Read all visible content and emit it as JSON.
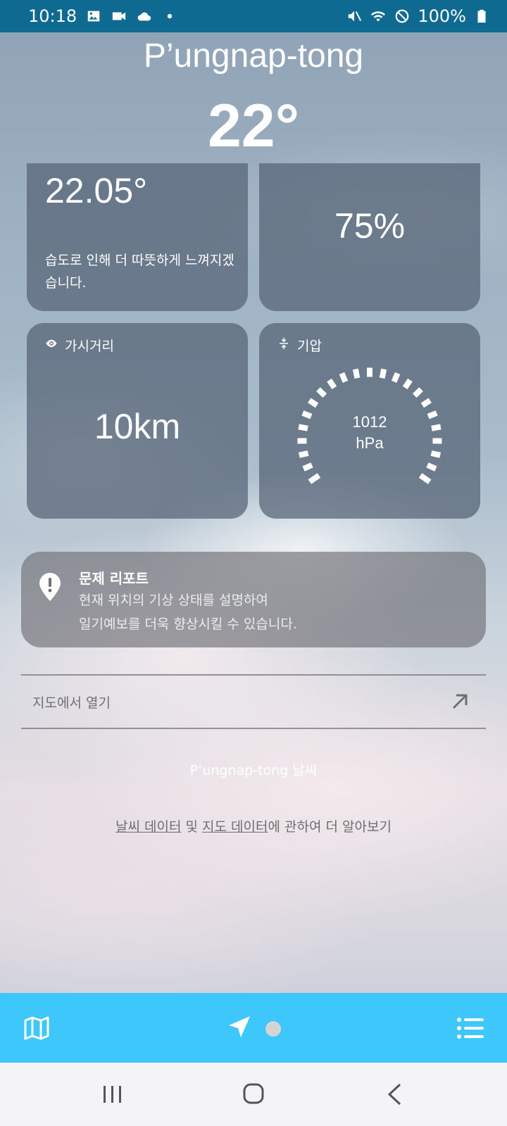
{
  "status_bar": {
    "time": "10:18",
    "battery": "100%",
    "left_icons": [
      "gallery-icon",
      "video-icon",
      "cloud-icon",
      "dot-icon"
    ],
    "right_icons": [
      "mute-icon",
      "wifi-icon",
      "blocked-icon",
      "battery-icon"
    ]
  },
  "header": {
    "city": "P’ungnap-tong",
    "temperature": "22°"
  },
  "feels_like": {
    "value": "22.05°",
    "description": "습도로 인해 더 따뜻하게 느껴지겠습니다."
  },
  "humidity": {
    "value": "75%"
  },
  "visibility": {
    "label": "가시거리",
    "value": "10km"
  },
  "pressure": {
    "label": "기압",
    "value": "1012",
    "unit": "hPa"
  },
  "report": {
    "title": "문제 리포트",
    "line1": "현재 위치의 기상 상태를 설명하여",
    "line2": "일기예보를 더욱 향상시킬 수 있습니다."
  },
  "map_link": {
    "label": "지도에서 열기"
  },
  "footer": {
    "city_weather": "P’ungnap-tong 날씨",
    "weather_data_link": "날씨 데이터",
    "and": " 및 ",
    "map_data_link": "지도 데이터",
    "learn_more": "에 관하여 더 알아보기"
  },
  "colors": {
    "status_bar": "#0f6a91",
    "app_bar": "#3ec7fb",
    "card": "#556374",
    "nav_bar": "#f4f3f6"
  }
}
